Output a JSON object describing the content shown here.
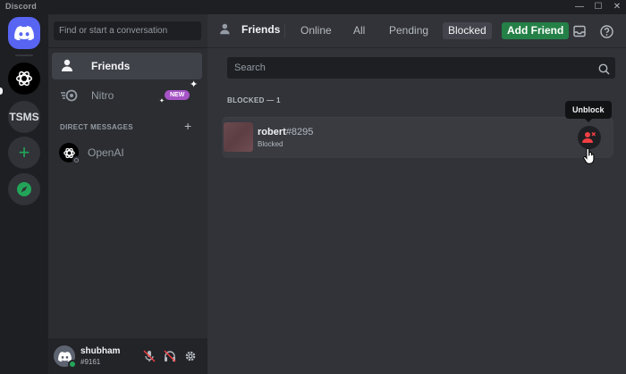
{
  "window": {
    "app_name": "Discord",
    "controls": {
      "minimize": "—",
      "maximize": "☐",
      "close": "✕"
    }
  },
  "servers": [
    {
      "name": "Home",
      "icon": "discord-logo-icon"
    },
    {
      "name": "OpenAI",
      "icon": "openai-logo-icon"
    },
    {
      "name": "TSMS",
      "label": "TSMS"
    },
    {
      "name": "Add a Server",
      "icon": "plus-icon"
    },
    {
      "name": "Explore Discoverable Servers",
      "icon": "compass-icon"
    }
  ],
  "sidebar": {
    "search_placeholder": "Find or start a conversation",
    "nav": [
      {
        "label": "Friends",
        "icon": "friends-icon",
        "active": true
      },
      {
        "label": "Nitro",
        "icon": "nitro-icon",
        "badge": "NEW"
      }
    ],
    "dm_header": "DIRECT MESSAGES",
    "dms": [
      {
        "name": "OpenAI",
        "status": "offline"
      }
    ]
  },
  "user": {
    "name": "shubham",
    "tag": "#9161",
    "status_color": "#23a559"
  },
  "topbar": {
    "title": "Friends",
    "tabs": [
      "Online",
      "All",
      "Pending",
      "Blocked"
    ],
    "active_tab": "Blocked",
    "add_friend": "Add Friend"
  },
  "main": {
    "search_placeholder": "Search",
    "section_header": "BLOCKED — 1",
    "blocked": [
      {
        "username": "robert",
        "discriminator": "#8295",
        "status": "Blocked"
      }
    ],
    "tooltip": "Unblock"
  },
  "colors": {
    "blurple": "#5865f2",
    "green": "#248046",
    "danger": "#f23f43",
    "nitro_badge": "#a653c6"
  }
}
